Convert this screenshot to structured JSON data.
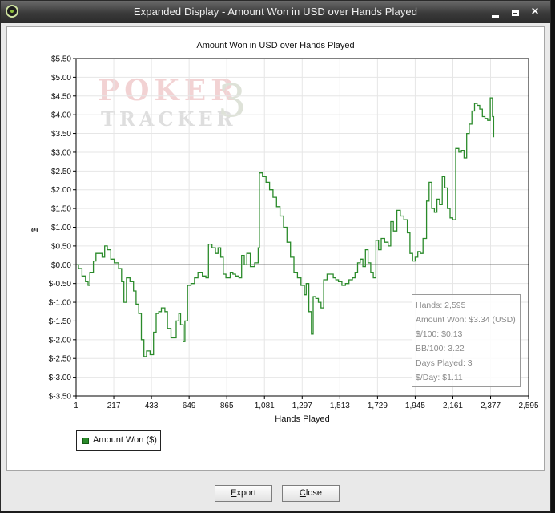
{
  "window": {
    "title": "Expanded Display - Amount Won in USD over Hands Played"
  },
  "watermark": {
    "brand_top": "POKER",
    "brand_bottom": "TRACKER",
    "brand_number": "3"
  },
  "stats": {
    "hands": "Hands: 2,595",
    "amount_won": "Amount Won: $3.34 (USD)",
    "per_100": "$/100: $0.13",
    "bb_100": "BB/100: 3.22",
    "days_played": "Days Played: 3",
    "per_day": "$/Day: $1.11"
  },
  "legend": {
    "label": "Amount Won ($)"
  },
  "buttons": {
    "export_accel": "E",
    "export_rest": "xport",
    "close_accel": "C",
    "close_rest": "lose"
  },
  "colors": {
    "series": "#2a8a2a",
    "grid": "#e6e6e6",
    "zero_line": "#000000"
  },
  "chart_data": {
    "type": "line",
    "title": "Amount Won in USD over Hands Played",
    "xlabel": "Hands Played",
    "ylabel": "$",
    "xlim": [
      1,
      2595
    ],
    "ylim": [
      -3.5,
      5.5
    ],
    "x_ticks": [
      1,
      217,
      433,
      649,
      865,
      1081,
      1297,
      1513,
      1729,
      1945,
      2161,
      2377,
      2595
    ],
    "x_tick_labels": [
      "1",
      "217",
      "433",
      "649",
      "865",
      "1,081",
      "1,297",
      "1,513",
      "1,729",
      "1,945",
      "2,161",
      "2,377",
      "2,595"
    ],
    "y_ticks": [
      5.5,
      5.0,
      4.5,
      4.0,
      3.5,
      3.0,
      2.5,
      2.0,
      1.5,
      1.0,
      0.5,
      0.0,
      -0.5,
      -1.0,
      -1.5,
      -2.0,
      -2.5,
      -3.0,
      -3.5
    ],
    "y_tick_labels": [
      "$5.50",
      "$5.00",
      "$4.50",
      "$4.00",
      "$3.50",
      "$3.00",
      "$2.50",
      "$2.00",
      "$1.50",
      "$1.00",
      "$0.50",
      "$0.00",
      "$-0.50",
      "$-1.00",
      "$-1.50",
      "$-2.00",
      "$-2.50",
      "$-3.00",
      "$-3.50"
    ],
    "grid": true,
    "legend_position": "bottom-left",
    "series": [
      {
        "name": "Amount Won ($)",
        "color": "#2a8a2a",
        "points": [
          [
            1,
            0.0
          ],
          [
            15,
            -0.1
          ],
          [
            35,
            -0.3
          ],
          [
            55,
            -0.45
          ],
          [
            70,
            -0.55
          ],
          [
            80,
            -0.2
          ],
          [
            100,
            0.1
          ],
          [
            115,
            0.3
          ],
          [
            135,
            0.3
          ],
          [
            150,
            0.2
          ],
          [
            165,
            0.5
          ],
          [
            180,
            0.4
          ],
          [
            200,
            0.15
          ],
          [
            220,
            0.05
          ],
          [
            245,
            -0.1
          ],
          [
            262,
            -0.45
          ],
          [
            275,
            -1.0
          ],
          [
            290,
            -0.35
          ],
          [
            310,
            -0.45
          ],
          [
            330,
            -0.7
          ],
          [
            345,
            -1.05
          ],
          [
            360,
            -1.3
          ],
          [
            375,
            -2.0
          ],
          [
            390,
            -2.45
          ],
          [
            405,
            -2.3
          ],
          [
            425,
            -2.4
          ],
          [
            445,
            -1.8
          ],
          [
            460,
            -1.3
          ],
          [
            475,
            -1.25
          ],
          [
            490,
            -1.15
          ],
          [
            510,
            -1.25
          ],
          [
            525,
            -1.7
          ],
          [
            545,
            -1.95
          ],
          [
            562,
            -1.95
          ],
          [
            575,
            -1.5
          ],
          [
            590,
            -1.3
          ],
          [
            600,
            -1.6
          ],
          [
            615,
            -2.05
          ],
          [
            625,
            -1.5
          ],
          [
            640,
            -0.55
          ],
          [
            660,
            -0.5
          ],
          [
            680,
            -0.35
          ],
          [
            700,
            -0.2
          ],
          [
            725,
            -0.3
          ],
          [
            745,
            -0.35
          ],
          [
            760,
            0.55
          ],
          [
            780,
            0.45
          ],
          [
            800,
            0.3
          ],
          [
            815,
            0.45
          ],
          [
            830,
            0.2
          ],
          [
            845,
            -0.25
          ],
          [
            860,
            -0.35
          ],
          [
            885,
            -0.2
          ],
          [
            900,
            -0.25
          ],
          [
            915,
            -0.3
          ],
          [
            935,
            -0.35
          ],
          [
            950,
            0.25
          ],
          [
            965,
            0.0
          ],
          [
            980,
            0.3
          ],
          [
            1000,
            -0.05
          ],
          [
            1025,
            0.05
          ],
          [
            1045,
            0.45
          ],
          [
            1052,
            2.45
          ],
          [
            1070,
            2.35
          ],
          [
            1090,
            2.2
          ],
          [
            1110,
            2.0
          ],
          [
            1130,
            1.8
          ],
          [
            1150,
            1.55
          ],
          [
            1170,
            1.3
          ],
          [
            1190,
            1.0
          ],
          [
            1210,
            0.6
          ],
          [
            1230,
            0.2
          ],
          [
            1250,
            -0.2
          ],
          [
            1270,
            -0.35
          ],
          [
            1290,
            -0.55
          ],
          [
            1310,
            -0.8
          ],
          [
            1320,
            -0.5
          ],
          [
            1335,
            -1.25
          ],
          [
            1350,
            -1.85
          ],
          [
            1360,
            -0.85
          ],
          [
            1375,
            -0.9
          ],
          [
            1390,
            -1.0
          ],
          [
            1405,
            -1.15
          ],
          [
            1420,
            -0.4
          ],
          [
            1440,
            -0.25
          ],
          [
            1460,
            -0.25
          ],
          [
            1475,
            -0.35
          ],
          [
            1490,
            -0.4
          ],
          [
            1505,
            -0.45
          ],
          [
            1525,
            -0.55
          ],
          [
            1545,
            -0.5
          ],
          [
            1565,
            -0.4
          ],
          [
            1585,
            -0.35
          ],
          [
            1600,
            -0.2
          ],
          [
            1615,
            0.05
          ],
          [
            1630,
            0.15
          ],
          [
            1645,
            -0.05
          ],
          [
            1660,
            0.4
          ],
          [
            1675,
            0.05
          ],
          [
            1690,
            -0.2
          ],
          [
            1705,
            -0.35
          ],
          [
            1720,
            0.65
          ],
          [
            1735,
            0.4
          ],
          [
            1750,
            0.7
          ],
          [
            1770,
            0.6
          ],
          [
            1790,
            0.5
          ],
          [
            1805,
            1.15
          ],
          [
            1820,
            0.9
          ],
          [
            1840,
            1.45
          ],
          [
            1860,
            1.3
          ],
          [
            1880,
            1.2
          ],
          [
            1900,
            0.85
          ],
          [
            1915,
            0.3
          ],
          [
            1930,
            0.1
          ],
          [
            1945,
            0.2
          ],
          [
            1960,
            0.35
          ],
          [
            1975,
            0.3
          ],
          [
            1990,
            0.7
          ],
          [
            2010,
            1.7
          ],
          [
            2025,
            2.2
          ],
          [
            2040,
            1.5
          ],
          [
            2055,
            1.4
          ],
          [
            2070,
            1.75
          ],
          [
            2085,
            1.6
          ],
          [
            2100,
            2.35
          ],
          [
            2115,
            2.05
          ],
          [
            2130,
            1.5
          ],
          [
            2145,
            1.25
          ],
          [
            2160,
            1.2
          ],
          [
            2177,
            3.1
          ],
          [
            2195,
            3.0
          ],
          [
            2210,
            3.05
          ],
          [
            2225,
            2.85
          ],
          [
            2240,
            3.5
          ],
          [
            2255,
            3.75
          ],
          [
            2270,
            4.1
          ],
          [
            2285,
            4.3
          ],
          [
            2300,
            4.25
          ],
          [
            2315,
            4.15
          ],
          [
            2330,
            3.95
          ],
          [
            2345,
            3.9
          ],
          [
            2360,
            3.85
          ],
          [
            2375,
            4.45
          ],
          [
            2388,
            3.95
          ],
          [
            2395,
            3.4
          ]
        ]
      }
    ]
  }
}
